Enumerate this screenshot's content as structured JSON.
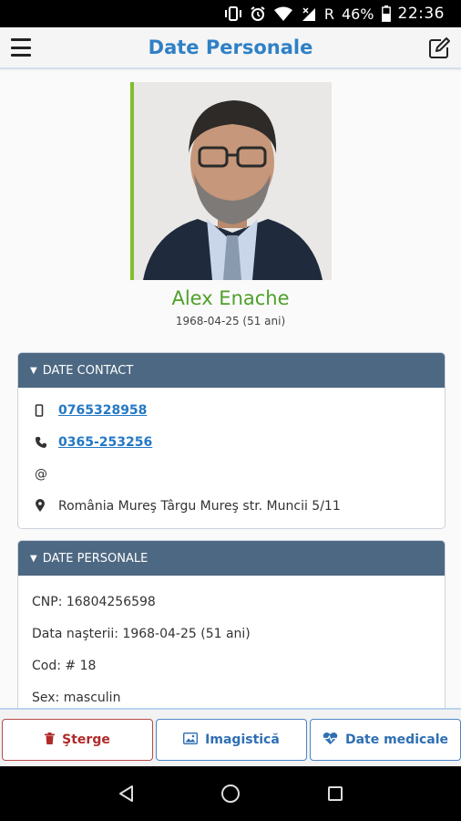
{
  "status_bar": {
    "network_label": "R",
    "battery": "46%",
    "time": "22:36",
    "icons": [
      "vibrate-icon",
      "alarm-icon",
      "wifi-icon",
      "signal-icon",
      "battery-icon"
    ]
  },
  "header": {
    "title": "Date Personale",
    "menu_icon": "hamburger-menu-icon",
    "edit_icon": "edit-icon"
  },
  "profile": {
    "name": "Alex Enache",
    "birth_line": "1968-04-25 (51 ani)"
  },
  "contact_panel": {
    "title": "DATE CONTACT",
    "mobile": "0765328958",
    "phone": "0365-253256",
    "email": "",
    "address": "România Mureş Târgu Mureş str. Muncii 5/11"
  },
  "personal_panel": {
    "title": "DATE PERSONALE",
    "cnp": "CNP: 16804256598",
    "birth": "Data naşterii: 1968-04-25 (51 ani)",
    "code": "Cod: # 18",
    "sex": "Sex: masculin"
  },
  "actions": {
    "delete": "Şterge",
    "imaging": "Imagistică",
    "medical": "Date medicale"
  },
  "colors": {
    "title_blue": "#2f80c6",
    "name_green": "#4fa02a",
    "panel_header": "#4d6882",
    "link_blue": "#2478c4",
    "delete_red": "#b02a2a"
  }
}
